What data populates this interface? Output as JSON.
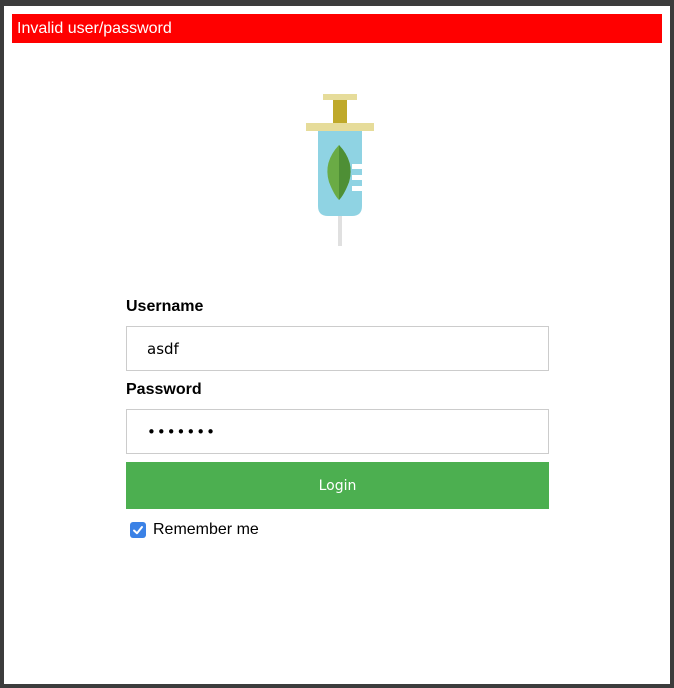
{
  "error": {
    "message": "Invalid user/password",
    "color": "#ff0000"
  },
  "logo": {
    "icon": "syringe-leaf-icon",
    "colors": {
      "plunger": "#bfa92a",
      "flange": "#e6dc9a",
      "barrel": "#8fd3e3",
      "leaf": "#6aab45",
      "needle": "#e0e0e0"
    }
  },
  "login": {
    "username_label": "Username",
    "username_value": "asdf",
    "password_label": "Password",
    "password_value": "asdfasd",
    "button_label": "Login",
    "button_color": "#4caf50",
    "remember_label": "Remember me",
    "remember_checked": true
  }
}
